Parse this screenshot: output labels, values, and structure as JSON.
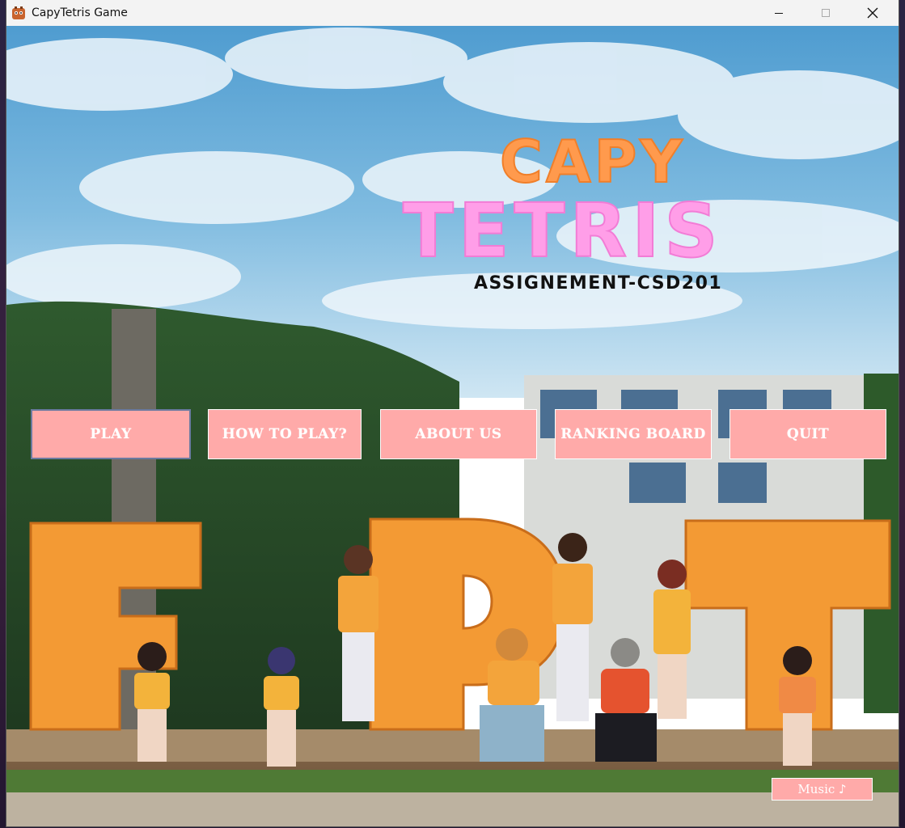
{
  "window": {
    "title": "CapyTetris Game",
    "minimize_icon": "minimize-icon",
    "maximize_icon": "maximize-icon",
    "close_icon": "close-icon"
  },
  "logo": {
    "line1": "CAPY",
    "line2": "TETRIS",
    "line1_color": "#ff9a4d",
    "line2_color": "#ff9ee8"
  },
  "subtitle": "ASSIGNEMENT-CSD201",
  "menu": {
    "buttons": [
      {
        "label": "PLAY"
      },
      {
        "label": "HOW TO PLAY?"
      },
      {
        "label": "ABOUT US"
      },
      {
        "label": "RANKING BOARD"
      },
      {
        "label": "QUIT"
      }
    ],
    "button_color": "#ffaaa9"
  },
  "music_button": "Music ♪",
  "background": {
    "letters": [
      "F",
      "P",
      "T"
    ],
    "letter_color": "#f39a34",
    "sky_color": "#5aa7d6"
  }
}
